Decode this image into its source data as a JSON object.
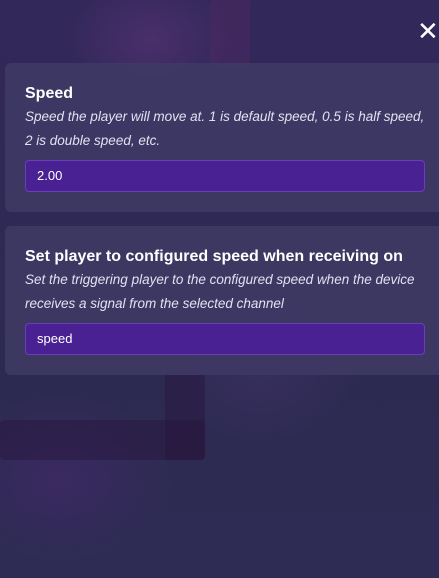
{
  "close_icon": "close-icon",
  "speed": {
    "title": "Speed",
    "description": "Speed the player will move at. 1 is default speed, 0.5 is half speed, 2 is double speed, etc.",
    "value": "2.00"
  },
  "trigger": {
    "title": "Set player to configured speed when receiving on",
    "description": "Set the triggering player to the configured speed when the device receives a signal from the selected channel",
    "value": "speed"
  },
  "colors": {
    "background": "#2f2a52",
    "card": "#3e3a64",
    "field": "#4a2193",
    "field_border": "#6a3fb6"
  }
}
